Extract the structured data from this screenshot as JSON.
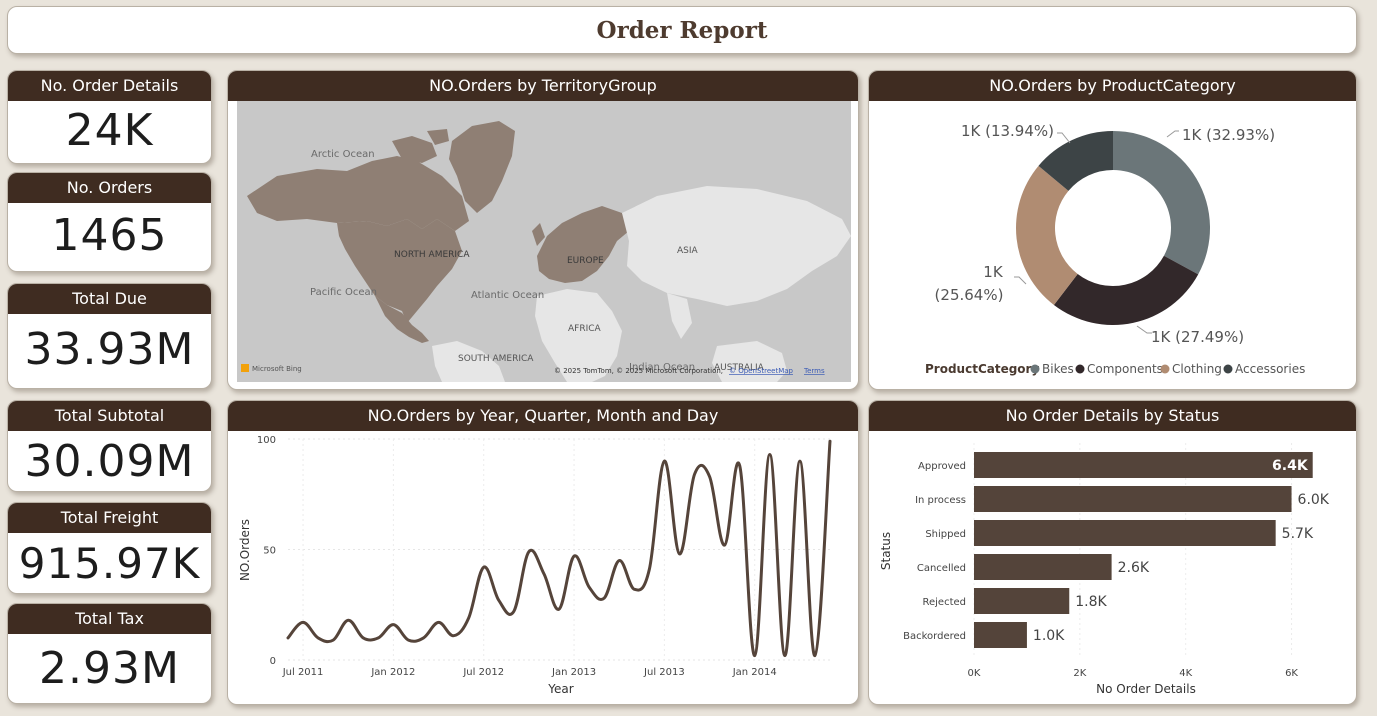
{
  "report": {
    "title": "Order Report"
  },
  "kpis": [
    {
      "label": "No. Order Details",
      "value": "24K"
    },
    {
      "label": "No. Orders",
      "value": "1465"
    },
    {
      "label": "Total Due",
      "value": "33.93M"
    },
    {
      "label": "Total Subtotal",
      "value": "30.09M"
    },
    {
      "label": "Total Freight",
      "value": "915.97K"
    },
    {
      "label": "Total Tax",
      "value": "2.93M"
    }
  ],
  "map": {
    "title": "NO.Orders by TerritoryGroup",
    "labels": {
      "arctic": "Arctic Ocean",
      "north_america": "NORTH AMERICA",
      "europe": "EUROPE",
      "asia": "ASIA",
      "pacific": "Pacific Ocean",
      "atlantic": "Atlantic Ocean",
      "africa": "AFRICA",
      "south_america": "SOUTH AMERICA",
      "indian": "Indian Ocean",
      "australia": "AUSTRALIA"
    },
    "brand": "Microsoft Bing",
    "copyright": "© 2025 TomTom, © 2025 Microsoft Corporation,",
    "osm": "© OpenStreetMap",
    "terms": "Terms",
    "colors": {
      "water": "#c8c8c8",
      "land": "#e6e6e6",
      "highlight": "#8f7f74"
    }
  },
  "donut": {
    "title": "NO.Orders by ProductCategory",
    "legend_title": "ProductCategory",
    "chart_data": {
      "type": "pie",
      "slices": [
        {
          "name": "Bikes",
          "percent": 32.93,
          "label": "1K (32.93%)",
          "color": "#6b7679"
        },
        {
          "name": "Components",
          "percent": 27.49,
          "label": "1K (27.49%)",
          "color": "#32282a"
        },
        {
          "name": "Clothing",
          "percent": 25.64,
          "label_line1": "1K",
          "label_line2": "(25.64%)",
          "color": "#b08c72"
        },
        {
          "name": "Accessories",
          "percent": 13.94,
          "label": "1K (13.94%)",
          "color": "#3d4446"
        }
      ]
    }
  },
  "line": {
    "title": "NO.Orders by Year, Quarter, Month and Day",
    "chart_data": {
      "type": "line",
      "xlabel": "Year",
      "ylabel": "NO.Orders",
      "ylim": [
        0,
        100
      ],
      "yticks": [
        0,
        50,
        100
      ],
      "xticks": [
        "Jul 2011",
        "Jan 2012",
        "Jul 2012",
        "Jan 2013",
        "Jul 2013",
        "Jan 2014"
      ],
      "color": "#55443a",
      "x": [
        "2011-06",
        "2011-07",
        "2011-08",
        "2011-09",
        "2011-10",
        "2011-11",
        "2011-12",
        "2012-01",
        "2012-02",
        "2012-03",
        "2012-04",
        "2012-05",
        "2012-06",
        "2012-07",
        "2012-08",
        "2012-09",
        "2012-10",
        "2012-11",
        "2012-12",
        "2013-01",
        "2013-02",
        "2013-03",
        "2013-04",
        "2013-05",
        "2013-06",
        "2013-07",
        "2013-08",
        "2013-09",
        "2013-10",
        "2013-11",
        "2013-12",
        "2014-01",
        "2014-02",
        "2014-03",
        "2014-04",
        "2014-05",
        "2014-06"
      ],
      "values": [
        10,
        17,
        10,
        9,
        18,
        10,
        10,
        16,
        9,
        10,
        17,
        11,
        19,
        42,
        27,
        22,
        49,
        39,
        23,
        47,
        33,
        28,
        45,
        32,
        41,
        90,
        48,
        84,
        83,
        52,
        88,
        2,
        93,
        2,
        90,
        2,
        99
      ]
    }
  },
  "bars": {
    "title": "No Order Details by Status",
    "chart_data": {
      "type": "bar",
      "orientation": "horizontal",
      "categories": [
        "Approved",
        "In process",
        "Shipped",
        "Cancelled",
        "Rejected",
        "Backordered"
      ],
      "values": [
        6400,
        6000,
        5700,
        2600,
        1800,
        1000
      ],
      "labels": [
        "6.4K",
        "6.0K",
        "5.7K",
        "2.6K",
        "1.8K",
        "1.0K"
      ],
      "xlabel": "No Order Details",
      "ylabel": "Status",
      "xlim": [
        0,
        6500
      ],
      "xticks": [
        {
          "value": 0,
          "label": "0K"
        },
        {
          "value": 2000,
          "label": "2K"
        },
        {
          "value": 4000,
          "label": "4K"
        },
        {
          "value": 6000,
          "label": "6K"
        }
      ],
      "color": "#54443a"
    }
  }
}
